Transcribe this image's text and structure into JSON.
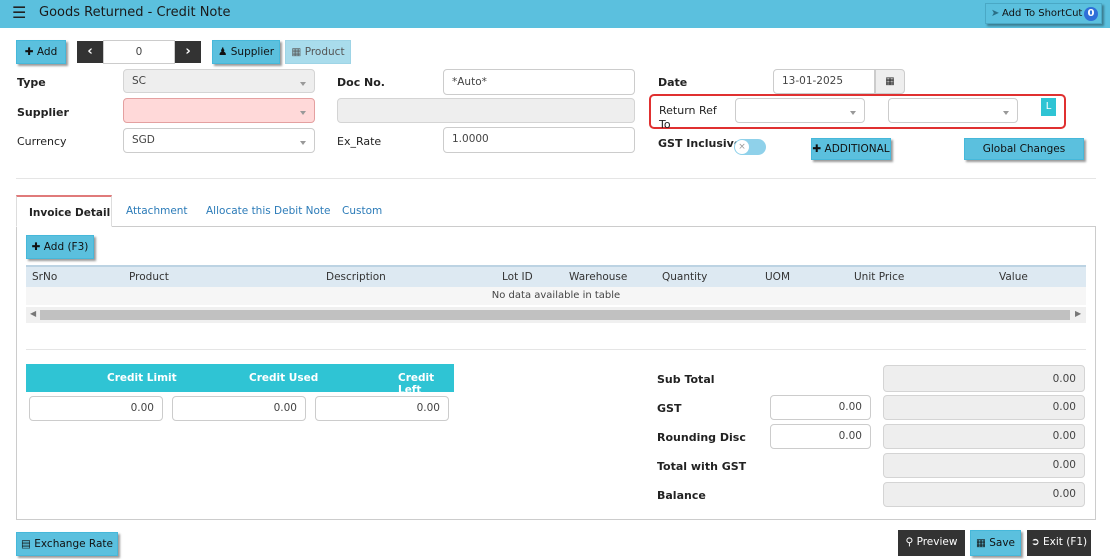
{
  "header": {
    "menu_icon": "hamburger-icon",
    "title": "Goods Returned - Credit Note",
    "shortcut_label": "Add To ShortCut",
    "shortcut_badge": "0"
  },
  "toolbar": {
    "add_label": "Add",
    "record_value": "0",
    "supplier_label": "Supplier",
    "product_label": "Product"
  },
  "form": {
    "type_label": "Type",
    "type_value": "SC",
    "supplier_label": "Supplier",
    "supplier_value": "",
    "currency_label": "Currency",
    "currency_value": "SGD",
    "docno_label": "Doc No.",
    "docno_value": "*Auto*",
    "exrate_label": "Ex_Rate",
    "exrate_value": "1.0000",
    "date_label": "Date",
    "date_value": "13-01-2025",
    "returnref_label_1": "Return Ref",
    "returnref_label_2": "To",
    "returnref_l": "L",
    "gst_inclusive_label": "GST Inclusive",
    "additional_label": "ADDITIONAL",
    "global_changes_label": "Global Changes"
  },
  "tabs": [
    {
      "label": "Invoice Detail"
    },
    {
      "label": "Attachment"
    },
    {
      "label": "Allocate this Debit Note"
    },
    {
      "label": "Custom"
    }
  ],
  "grid": {
    "add_label": "Add (F3)",
    "columns": [
      "SrNo",
      "Product",
      "Description",
      "Lot ID",
      "Warehouse",
      "Quantity",
      "UOM",
      "Unit Price",
      "Value"
    ],
    "empty_text": "No data available in table"
  },
  "credit": {
    "limit_label": "Credit Limit",
    "used_label": "Credit Used",
    "left_label": "Credit Left",
    "limit_value": "0.00",
    "used_value": "0.00",
    "left_value": "0.00"
  },
  "totals": {
    "subtotal_label": "Sub Total",
    "subtotal_value": "0.00",
    "gst_label": "GST",
    "gst_rate": "0.00",
    "gst_value": "0.00",
    "rounding_label": "Rounding Disc",
    "rounding_input": "0.00",
    "rounding_value": "0.00",
    "total_label": "Total with GST",
    "total_value": "0.00",
    "balance_label": "Balance",
    "balance_value": "0.00"
  },
  "footer": {
    "exchange_rate_label": "Exchange Rate",
    "preview_label": "Preview",
    "save_label": "Save",
    "exit_label": "Exit (F1)"
  }
}
